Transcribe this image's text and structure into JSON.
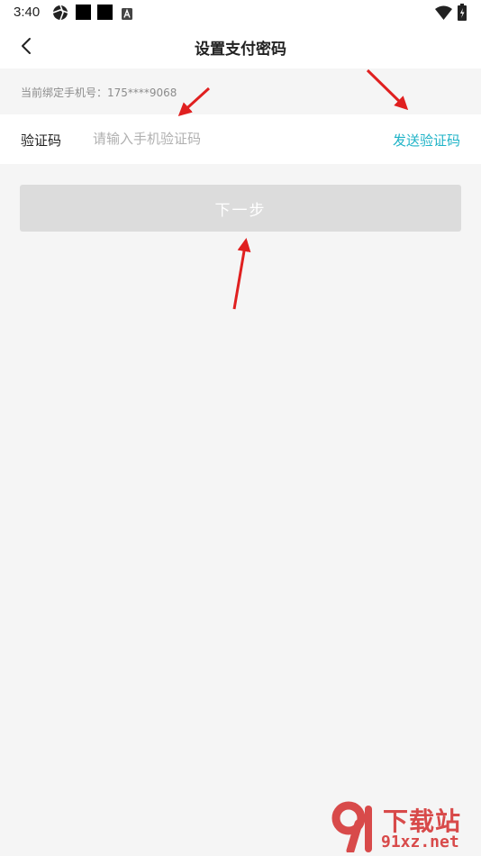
{
  "status_bar": {
    "time": "3:40",
    "icons": [
      "aperture-icon",
      "square-icon",
      "square-icon",
      "a-badge-icon",
      "wifi-icon",
      "battery-charging-icon"
    ]
  },
  "header": {
    "title": "设置支付密码",
    "back_icon": "chevron-left-icon"
  },
  "phone_hint": "当前绑定手机号：175****9068",
  "verification": {
    "label": "验证码",
    "placeholder": "请输入手机验证码",
    "value": "",
    "send_label": "发送验证码"
  },
  "next_button": {
    "label": "下一步"
  },
  "colors": {
    "accent": "#1fb3c7",
    "button_disabled": "#dcdcdc",
    "background": "#f5f5f5",
    "annotation_arrow": "#e02020",
    "watermark": "#d84a4a"
  },
  "watermark": {
    "text": "下载站",
    "url": "91xz.net"
  }
}
